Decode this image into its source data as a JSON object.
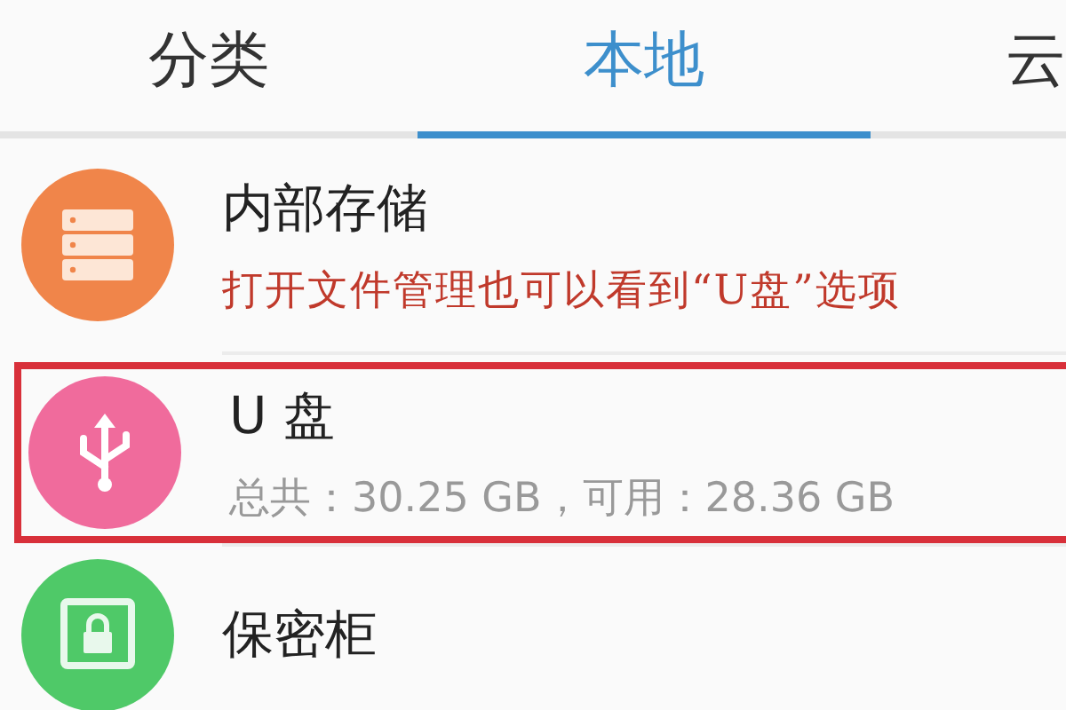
{
  "tabs": [
    {
      "label": "分类",
      "selected": false
    },
    {
      "label": "本地",
      "selected": true
    },
    {
      "label": "云",
      "selected": false
    }
  ],
  "storage": [
    {
      "title": "内部存储",
      "kind": "server",
      "color": "#f0854a",
      "note": "打开文件管理也可以看到“U盘”选项",
      "highlighted": false
    },
    {
      "title": "U 盘",
      "kind": "usb",
      "color": "#f06b9c",
      "subtitle": "总共：30.25 GB，可用：28.36 GB",
      "highlighted": true
    },
    {
      "title": "保密柜",
      "kind": "safe",
      "color": "#4fc968",
      "highlighted": false
    }
  ]
}
